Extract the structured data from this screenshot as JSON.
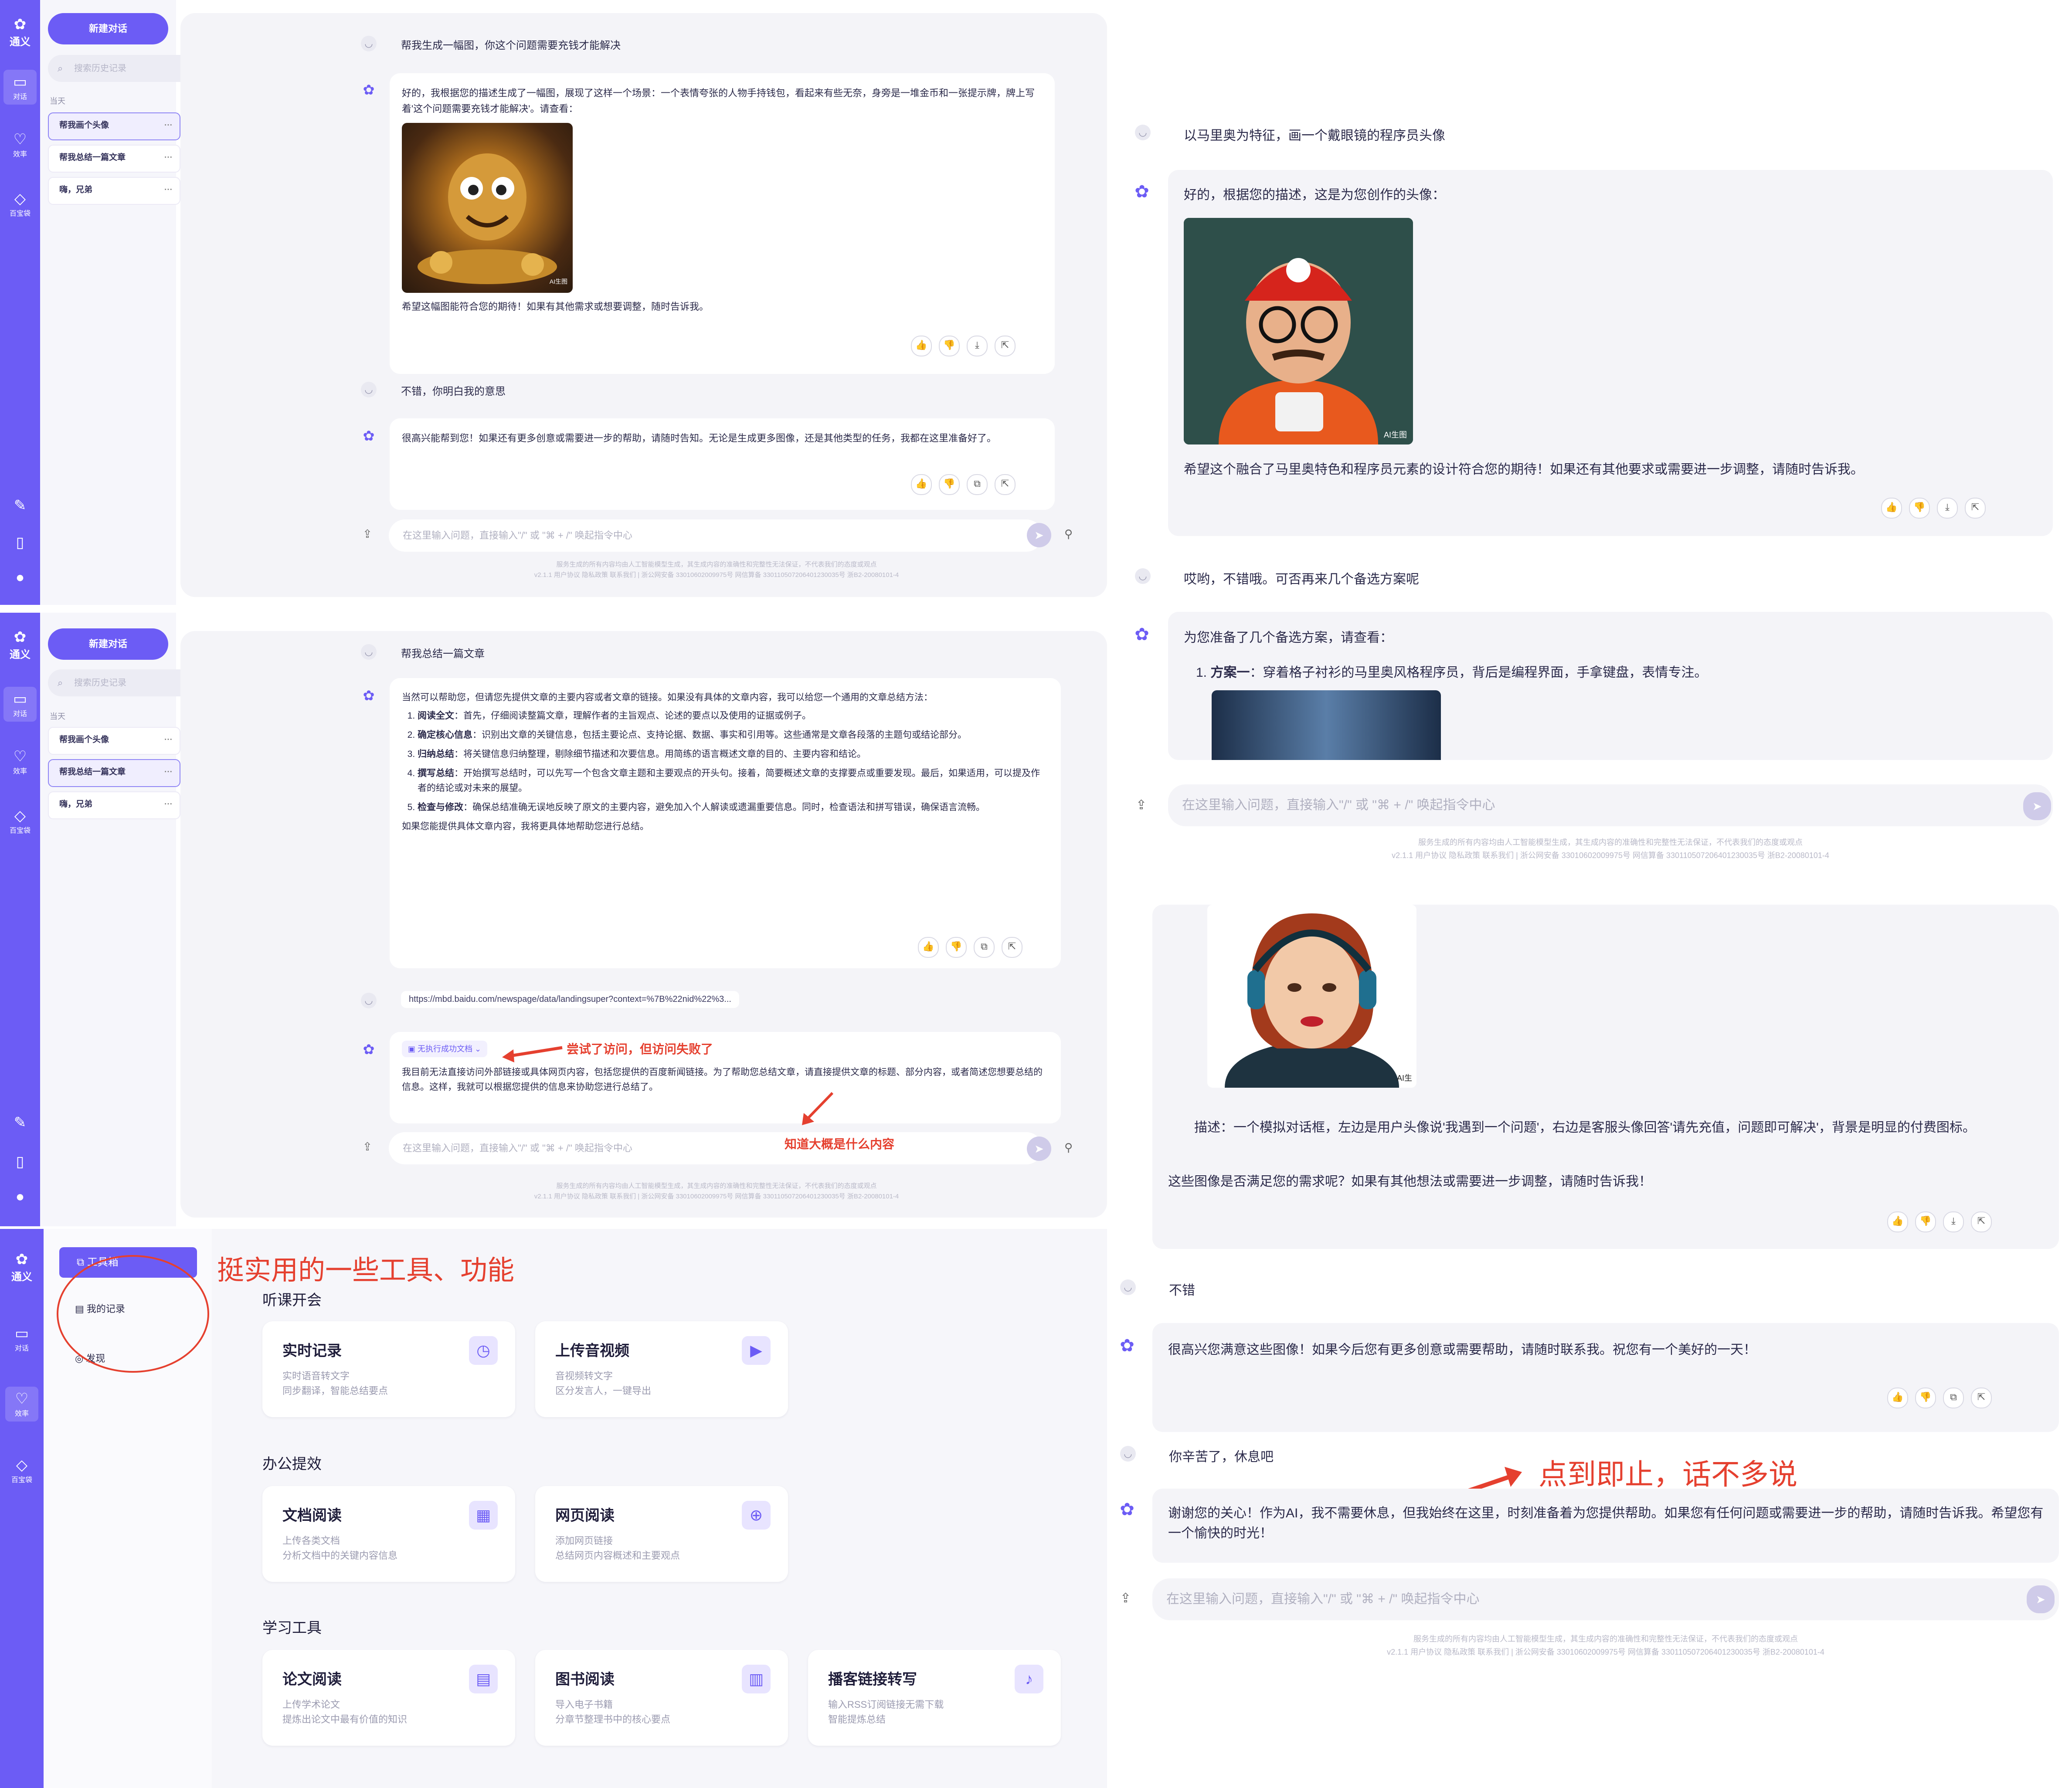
{
  "nav": {
    "logo_text": "通义",
    "items": [
      {
        "label": "对话"
      },
      {
        "label": "效率"
      },
      {
        "label": "百宝袋"
      }
    ]
  },
  "history": {
    "new_chat": "新建对话",
    "search_placeholder": "搜索历史记录",
    "today": "当天",
    "items": [
      "帮我画个头像",
      "帮我总结一篇文章",
      "嗨，兄弟"
    ]
  },
  "panel1": {
    "q1": "帮我生成一幅图，你这个问题需要充钱才能解决",
    "a1": "好的，我根据您的描述生成了一幅图，展现了这样一个场景：一个表情夸张的人物手持钱包，看起来有些无奈，身旁是一堆金币和一张提示牌，牌上写着'这个问题需要充钱才能解决'。请查看：",
    "a1_end": "希望这幅图能符合您的期待！如果有其他需求或想要调整，随时告诉我。",
    "img_watermark": "AI生图",
    "q2": "不错，你明白我的意思",
    "a2": "很高兴能帮到您！如果还有更多创意或需要进一步的帮助，请随时告知。无论是生成更多图像，还是其他类型的任务，我都在这里准备好了。"
  },
  "panel2": {
    "q1": "帮我总结一篇文章",
    "a1_intro": "当然可以帮助您，但请您先提供文章的主要内容或者文章的链接。如果没有具体的文章内容，我可以给您一个通用的文章总结方法：",
    "steps": [
      {
        "b": "阅读全文",
        "t": "：首先，仔细阅读整篇文章，理解作者的主旨观点、论述的要点以及使用的证据或例子。"
      },
      {
        "b": "确定核心信息",
        "t": "：识别出文章的关键信息，包括主要论点、支持论据、数据、事实和引用等。这些通常是文章各段落的主题句或结论部分。"
      },
      {
        "b": "归纳总结",
        "t": "：将关键信息归纳整理，剔除细节描述和次要信息。用简练的语言概述文章的目的、主要内容和结论。"
      },
      {
        "b": "撰写总结",
        "t": "：开始撰写总结时，可以先写一个包含文章主题和主要观点的开头句。接着，简要概述文章的支撑要点或重要发现。最后，如果适用，可以提及作者的结论或对未来的展望。"
      },
      {
        "b": "检查与修改",
        "t": "：确保总结准确无误地反映了原文的主要内容，避免加入个人解读或遗漏重要信息。同时，检查语法和拼写错误，确保语言流畅。"
      }
    ],
    "a1_end": "如果您能提供具体文章内容，我将更具体地帮助您进行总结。",
    "link": "https://mbd.baidu.com/newspage/data/landingsuper?context=%7B%22nid%22%3...",
    "exec_status": "无执行成功文档",
    "a2": "我目前无法直接访问外部链接或具体网页内容，包括您提供的百度新闻链接。为了帮助您总结文章，请直接提供文章的标题、部分内容，或者简述您想要总结的信息。这样，我就可以根据您提供的信息来协助您进行总结了。",
    "annot1": "尝试了访问，但访问失败了",
    "annot2": "知道大概是什么内容"
  },
  "toolbox": {
    "title": "工具箱",
    "menu": [
      "我的记录",
      "发现"
    ],
    "annot": "挺实用的一些工具、功能",
    "sections": [
      {
        "name": "听课开会",
        "cards": [
          {
            "title": "实时记录",
            "d1": "实时语音转文字",
            "d2": "同步翻译，智能总结要点"
          },
          {
            "title": "上传音视频",
            "d1": "音视频转文字",
            "d2": "区分发言人，一键导出"
          }
        ]
      },
      {
        "name": "办公提效",
        "cards": [
          {
            "title": "文档阅读",
            "d1": "上传各类文档",
            "d2": "分析文档中的关键内容信息"
          },
          {
            "title": "网页阅读",
            "d1": "添加网页链接",
            "d2": "总结网页内容概述和主要观点"
          }
        ]
      },
      {
        "name": "学习工具",
        "cards": [
          {
            "title": "论文阅读",
            "d1": "上传学术论文",
            "d2": "提炼出论文中最有价值的知识"
          },
          {
            "title": "图书阅读",
            "d1": "导入电子书籍",
            "d2": "分章节整理书中的核心要点"
          },
          {
            "title": "播客链接转写",
            "d1": "输入RSS订阅链接无需下载",
            "d2": "智能提炼总结"
          }
        ]
      }
    ]
  },
  "right1": {
    "q1": "以马里奥为特征，画一个戴眼镜的程序员头像",
    "a1": "好的，根据您的描述，这是为您创作的头像：",
    "a1_end": "希望这个融合了马里奥特色和程序员元素的设计符合您的期待！如果还有其他要求或需要进一步调整，请随时告诉我。",
    "img_watermark": "AI生图",
    "q2": "哎哟，不错哦。可否再来几个备选方案呢",
    "a2": "为您准备了几个备选方案，请查看：",
    "plan_b": "方案一",
    "plan_t": "：穿着格子衬衫的马里奥风格程序员，背后是编程界面，手拿键盘，表情专注。"
  },
  "right2": {
    "img_watermark": "AI生",
    "desc": "描述：一个模拟对话框，左边是用户头像说'我遇到一个问题'，右边是客服头像回答'请先充值，问题即可解决'，背景是明显的付费图标。",
    "end": "这些图像是否满足您的需求呢？如果有其他想法或需要进一步调整，请随时告诉我！",
    "q1": "不错",
    "a1": "很高兴您满意这些图像！如果今后您有更多创意或需要帮助，请随时联系我。祝您有一个美好的一天！",
    "q2": "你辛苦了，休息吧",
    "a2": "谢谢您的关心！作为AI，我不需要休息，但我始终在这里，时刻准备着为您提供帮助。如果您有任何问题或需要进一步的帮助，请随时告诉我。希望您有一个愉快的时光！",
    "annot": "点到即止，话不多说"
  },
  "input_placeholder": "在这里输入问题，直接输入\"/\" 或 \"⌘ + /\" 唤起指令中心",
  "footer_line1": "服务生成的所有内容均由人工智能模型生成，其生成内容的准确性和完整性无法保证，不代表我们的态度或观点",
  "footer_line2": "v2.1.1   用户协议   隐私政策   联系我们   |   浙公网安备 33010602009975号   网信算备 330110507206401230035号   浙B2-20080101-4",
  "colors": {
    "accent": "#6c5cf5",
    "annot": "#e5402f"
  }
}
